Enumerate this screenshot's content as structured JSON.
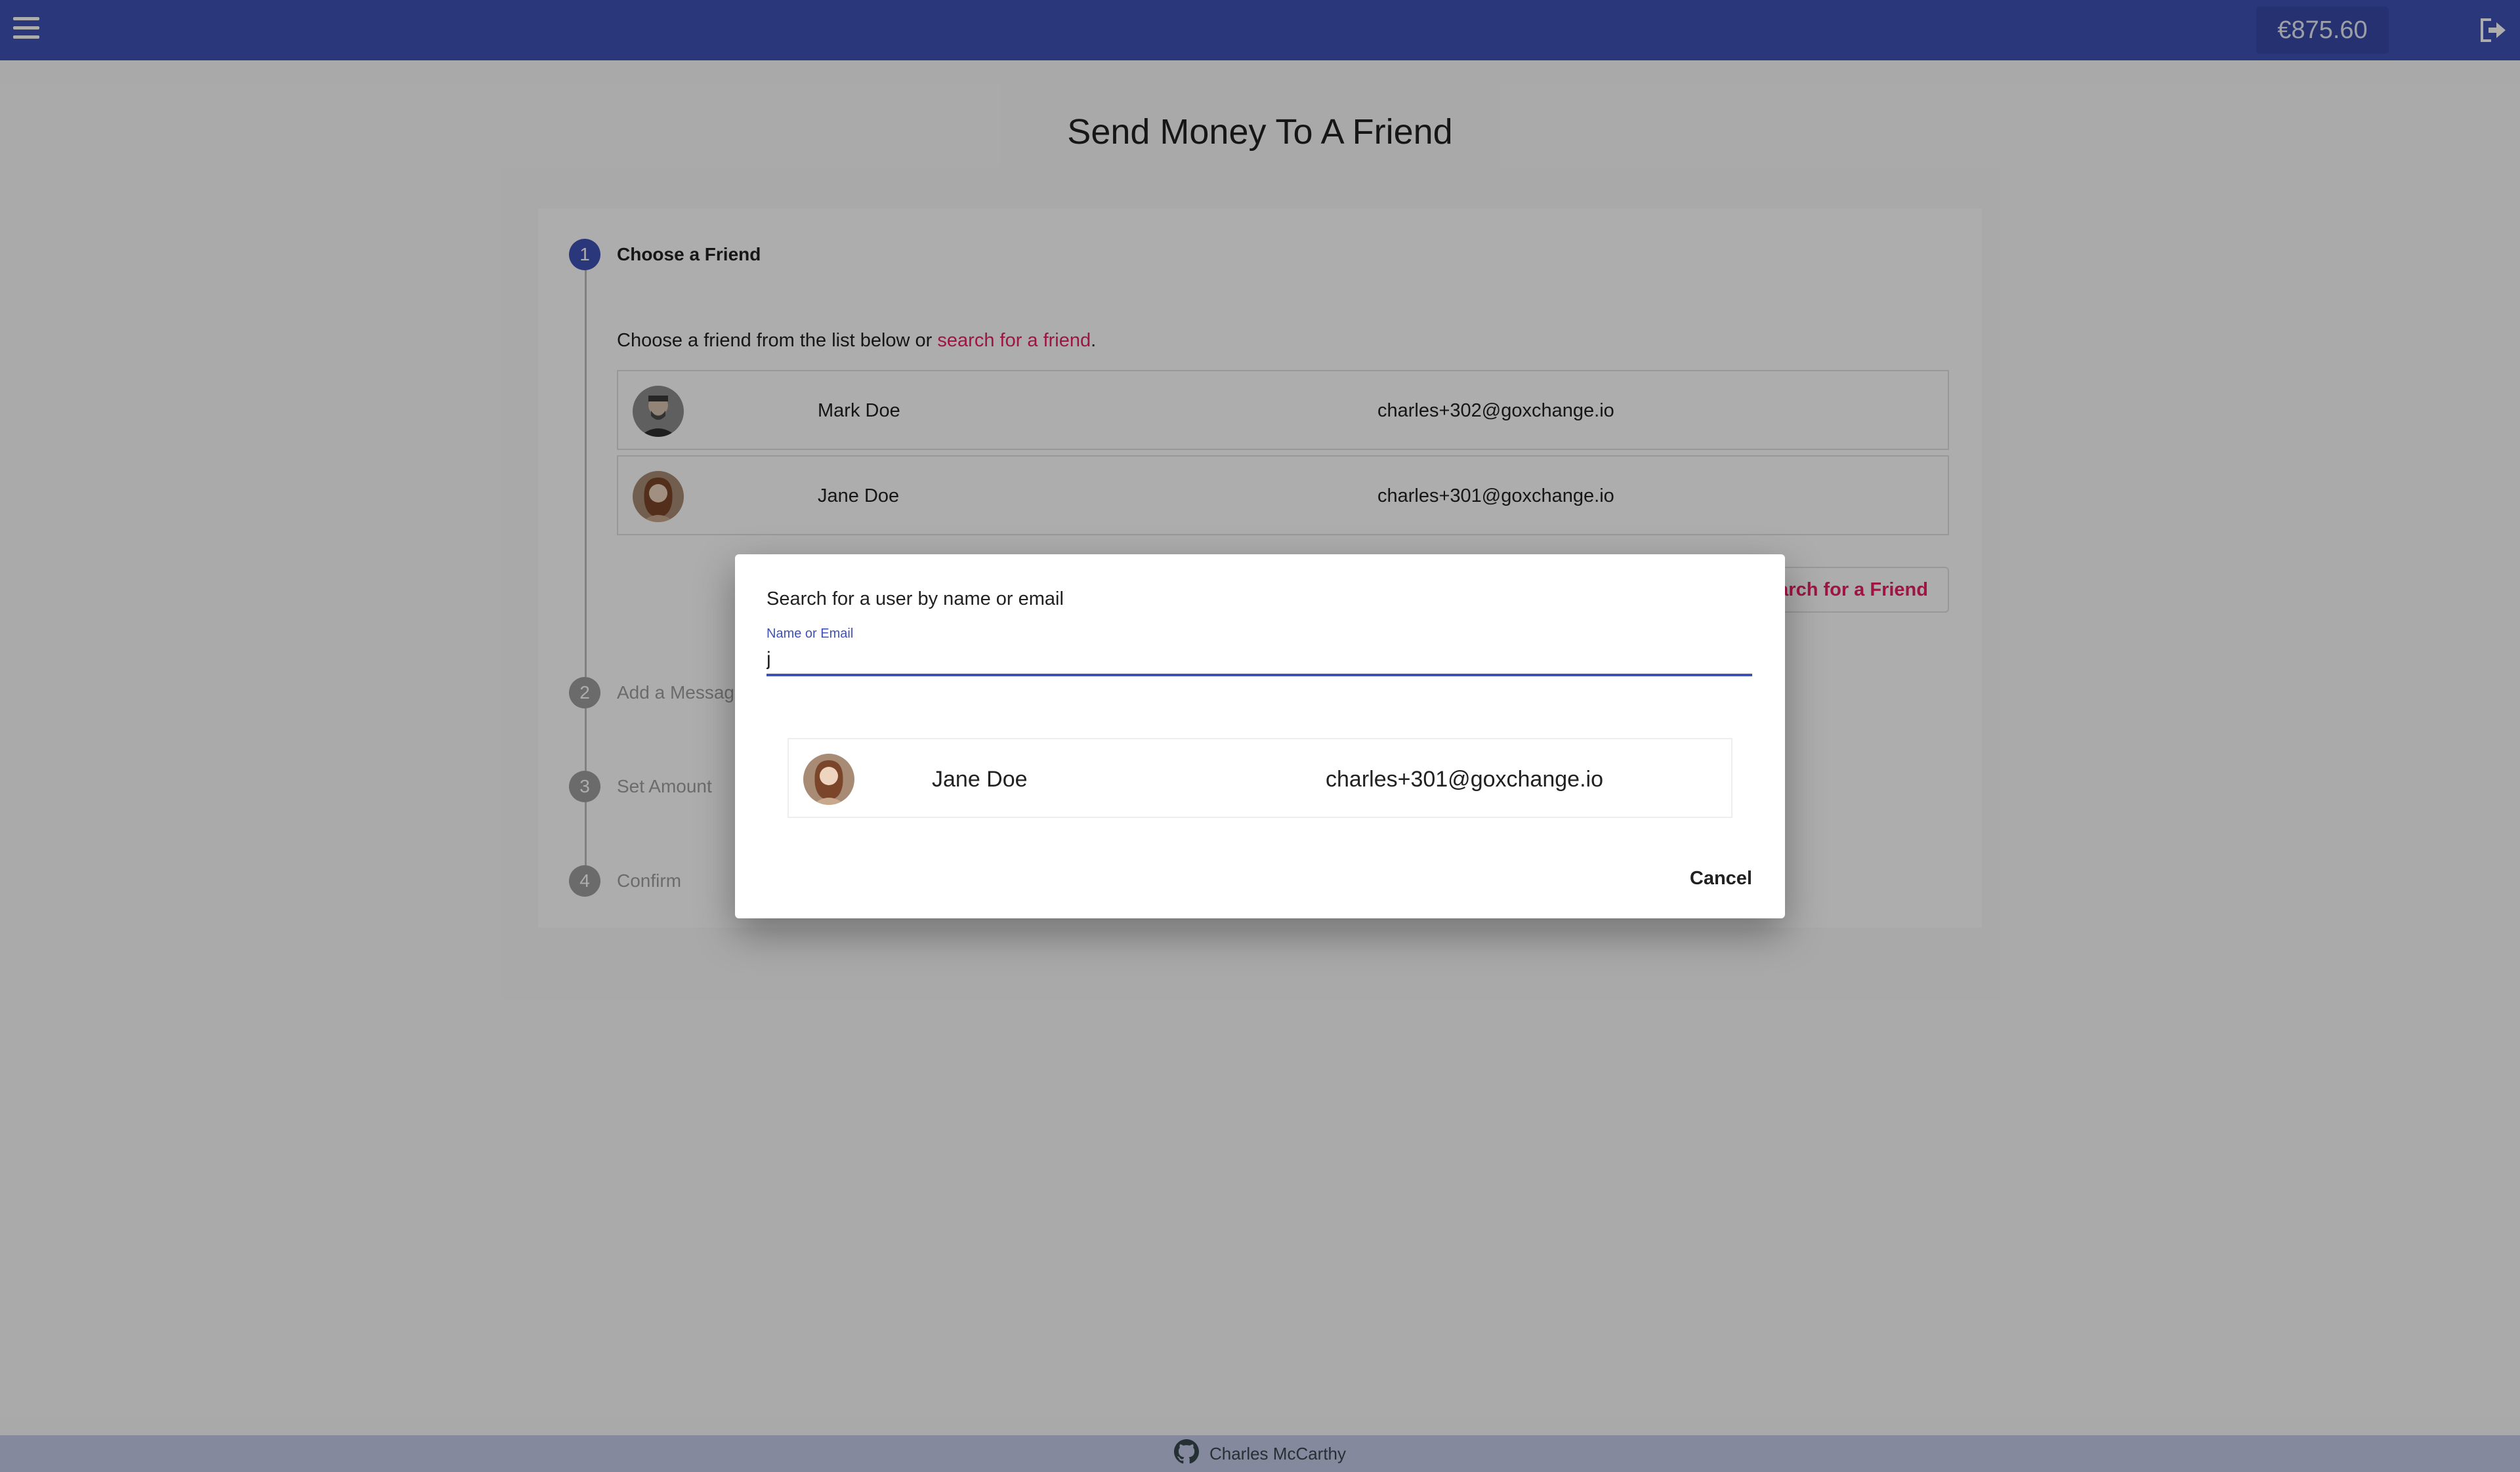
{
  "header": {
    "balance": "€875.60",
    "menu_icon": "hamburger-menu-icon",
    "logout_icon": "logout-icon",
    "color": "#3f51b5"
  },
  "page": {
    "title": "Send Money To A Friend"
  },
  "stepper": {
    "steps": [
      {
        "number": "1",
        "label": "Choose a Friend",
        "active": true
      },
      {
        "number": "2",
        "label": "Add a Message",
        "active": false
      },
      {
        "number": "3",
        "label": "Set Amount",
        "active": false
      },
      {
        "number": "4",
        "label": "Confirm",
        "active": false
      }
    ],
    "intro_prefix": "Choose a friend from the list below or ",
    "intro_link": "search for a friend",
    "intro_suffix": ".",
    "friends": [
      {
        "name": "Mark Doe",
        "email": "charles+302@goxchange.io"
      },
      {
        "name": "Jane Doe",
        "email": "charles+301@goxchange.io"
      }
    ],
    "search_button": "Search for a Friend"
  },
  "dialog": {
    "title": "Search for a user by name or email",
    "field_label": "Name or Email",
    "field_value": "j",
    "results": [
      {
        "name": "Jane Doe",
        "email": "charles+301@goxchange.io"
      }
    ],
    "cancel_label": "Cancel"
  },
  "footer": {
    "author": "Charles McCarthy",
    "icon": "github-icon"
  },
  "colors": {
    "primary": "#3f51b5",
    "accent": "#e91e63"
  }
}
